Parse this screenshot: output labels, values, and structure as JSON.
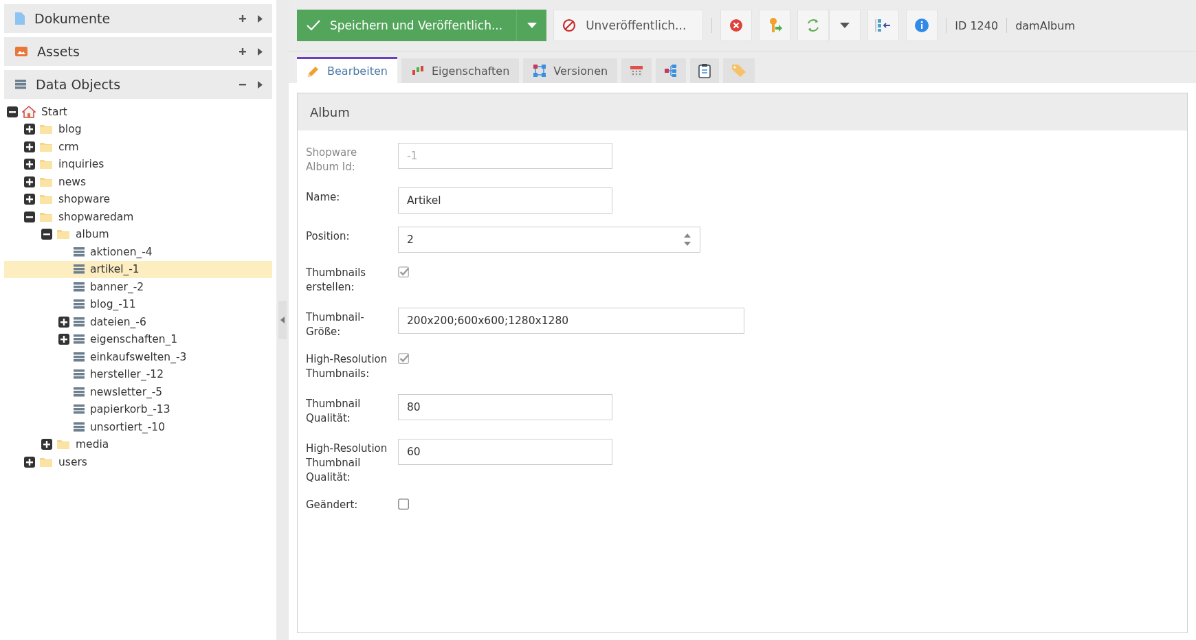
{
  "sidebar": {
    "sections": [
      {
        "title": "Dokumente",
        "kind": "document",
        "expanded": false
      },
      {
        "title": "Assets",
        "kind": "image",
        "expanded": false
      },
      {
        "title": "Data Objects",
        "kind": "data",
        "expanded": true
      }
    ],
    "tree": [
      {
        "label": "Start",
        "kind": "home",
        "expanded": true,
        "selected": false,
        "children": [
          {
            "label": "blog",
            "kind": "folder",
            "expanded": false,
            "selected": false
          },
          {
            "label": "crm",
            "kind": "folder",
            "expanded": false,
            "selected": false
          },
          {
            "label": "inquiries",
            "kind": "folder",
            "expanded": false,
            "selected": false
          },
          {
            "label": "news",
            "kind": "folder",
            "expanded": false,
            "selected": false
          },
          {
            "label": "shopware",
            "kind": "folder",
            "expanded": false,
            "selected": false
          },
          {
            "label": "shopwaredam",
            "kind": "folder",
            "expanded": true,
            "selected": false,
            "children": [
              {
                "label": "album",
                "kind": "folder",
                "expanded": true,
                "selected": false,
                "children": [
                  {
                    "label": "aktionen_-4",
                    "kind": "object",
                    "selected": false
                  },
                  {
                    "label": "artikel_-1",
                    "kind": "object",
                    "selected": true
                  },
                  {
                    "label": "banner_-2",
                    "kind": "object",
                    "selected": false
                  },
                  {
                    "label": "blog_-11",
                    "kind": "object",
                    "selected": false
                  },
                  {
                    "label": "dateien_-6",
                    "kind": "object",
                    "expanded": false,
                    "selected": false
                  },
                  {
                    "label": "eigenschaften_1",
                    "kind": "object",
                    "expanded": false,
                    "selected": false
                  },
                  {
                    "label": "einkaufswelten_-3",
                    "kind": "object",
                    "selected": false
                  },
                  {
                    "label": "hersteller_-12",
                    "kind": "object",
                    "selected": false
                  },
                  {
                    "label": "newsletter_-5",
                    "kind": "object",
                    "selected": false
                  },
                  {
                    "label": "papierkorb_-13",
                    "kind": "object",
                    "selected": false
                  },
                  {
                    "label": "unsortiert_-10",
                    "kind": "object",
                    "selected": false
                  }
                ]
              },
              {
                "label": "media",
                "kind": "folder",
                "expanded": false,
                "selected": false
              }
            ]
          },
          {
            "label": "users",
            "kind": "folder",
            "expanded": false,
            "selected": false
          }
        ]
      }
    ]
  },
  "toolbar": {
    "save_label": "Speichern und Veröffentlich...",
    "unpublish_label": "Unveröffentlich...",
    "id_text": "ID 1240",
    "class_name": "damAlbum"
  },
  "tabs": [
    {
      "label": "Bearbeiten",
      "kind": "edit",
      "selected": true
    },
    {
      "label": "Eigenschaften",
      "kind": "properties",
      "selected": false
    },
    {
      "label": "Versionen",
      "kind": "versions",
      "selected": false
    },
    {
      "kind": "schedule",
      "selected": false
    },
    {
      "kind": "dependencies",
      "selected": false
    },
    {
      "kind": "notes",
      "selected": false
    },
    {
      "kind": "tags",
      "selected": false
    }
  ],
  "form": {
    "title": "Album",
    "fields": [
      {
        "label": "Shopware Album Id:",
        "kind": "text",
        "value": "-1",
        "disabled": true
      },
      {
        "label": "Name:",
        "kind": "text",
        "value": "Artikel",
        "disabled": false
      },
      {
        "label": "Position:",
        "kind": "number",
        "value": "2",
        "disabled": false
      },
      {
        "label": "Thumbnails erstellen:",
        "kind": "checkbox",
        "checked": true,
        "disabled": true
      },
      {
        "label": "Thumbnail-Größe:",
        "kind": "long_text",
        "value": "200x200;600x600;1280x1280",
        "disabled": false
      },
      {
        "label": "High-Resolution Thumbnails:",
        "kind": "checkbox",
        "checked": true,
        "disabled": true
      },
      {
        "label": "Thumbnail Qualität:",
        "kind": "text",
        "value": "80",
        "disabled": false
      },
      {
        "label": "High-Resolution Thumbnail Qualität:",
        "kind": "text",
        "value": "60",
        "disabled": false
      },
      {
        "label": "Geändert:",
        "kind": "checkbox",
        "checked": false,
        "disabled": false
      }
    ]
  }
}
